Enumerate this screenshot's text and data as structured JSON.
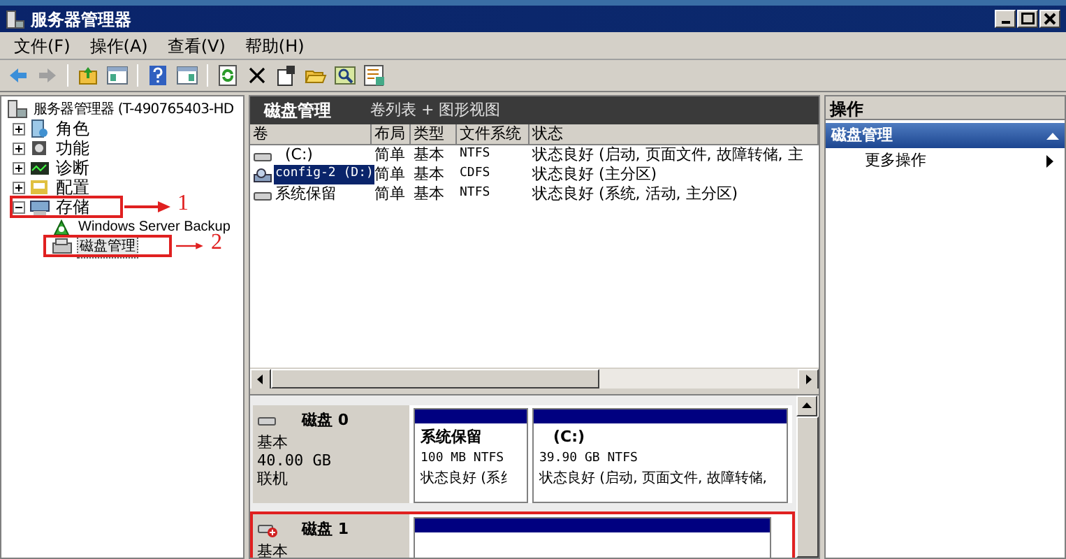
{
  "window": {
    "title": "服务器管理器"
  },
  "menu": [
    "文件(F)",
    "操作(A)",
    "查看(V)",
    "帮助(H)"
  ],
  "tree": {
    "label": "服务器管理器 (T-490765403-HD",
    "children": [
      {
        "label": "角色",
        "expanded": false,
        "selected": false
      },
      {
        "label": "功能",
        "expanded": false,
        "selected": false
      },
      {
        "label": "诊断",
        "expanded": false,
        "selected": false
      },
      {
        "label": "配置",
        "expanded": false,
        "selected": false
      },
      {
        "label": "存储",
        "expanded": true,
        "selected": false,
        "annotation": "1",
        "children": [
          {
            "label": "Windows Server Backup",
            "selected": false
          },
          {
            "label": "磁盘管理",
            "selected": true,
            "annotation": "2"
          }
        ]
      }
    ]
  },
  "center": {
    "title": "磁盘管理",
    "subtitle": "卷列表 + 图形视图",
    "columns": [
      "卷",
      "布局",
      "类型",
      "文件系统",
      "状态"
    ],
    "volumes": [
      {
        "kind": "disk",
        "name": "(C:)",
        "layout": "简单",
        "type": "基本",
        "fs": "NTFS",
        "status": "状态良好 (启动, 页面文件, 故障转储, 主",
        "selected": false
      },
      {
        "kind": "cd",
        "name": "config-2 (D:)",
        "layout": "简单",
        "type": "基本",
        "fs": "CDFS",
        "status": "状态良好 (主分区)",
        "selected": true
      },
      {
        "kind": "disk",
        "name": "系统保留",
        "layout": "简单",
        "type": "基本",
        "fs": "NTFS",
        "status": "状态良好 (系统, 活动, 主分区)",
        "selected": false
      }
    ],
    "disks": [
      {
        "kind": "online",
        "name": "磁盘 0",
        "lines": [
          "基本",
          "40.00 GB",
          "联机"
        ],
        "highlighted": false,
        "partitions": [
          {
            "kind": "volume",
            "name": "系统保留",
            "detail": "100 MB NTFS",
            "status": "状态良好 (系纟"
          },
          {
            "kind": "volume",
            "name": "(C:)",
            "detail": "39.90 GB NTFS",
            "status": "状态良好 (启动, 页面文件, 故障转储,"
          }
        ]
      },
      {
        "kind": "offline",
        "name": "磁盘 1",
        "lines": [
          "基本"
        ],
        "highlighted": true,
        "partitions": [
          {
            "kind": "blank"
          }
        ]
      }
    ]
  },
  "actions": {
    "title": "操作",
    "section": "磁盘管理",
    "items": [
      "更多操作"
    ]
  }
}
